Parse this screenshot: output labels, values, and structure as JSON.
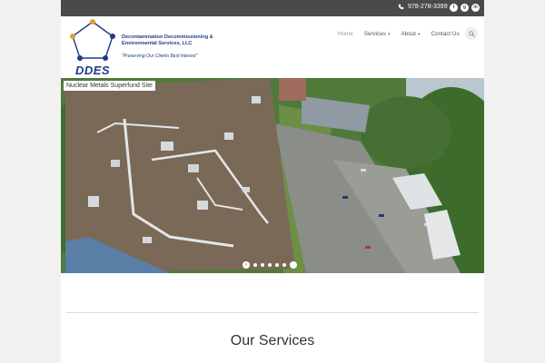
{
  "topbar": {
    "phone": "978-278-3399",
    "social_icons": [
      "twitter-icon",
      "google-plus-icon",
      "linkedin-icon"
    ]
  },
  "logo": {
    "mark_text": "DDES",
    "company_name": "Decontamination Decommissioning & Environmental Services, LLC",
    "tagline": "\"Preserving Our Clients Best Interest\""
  },
  "nav": {
    "home": "Home",
    "services": "Services",
    "about": "About",
    "contact": "Contact Us"
  },
  "slider": {
    "caption": "Nuclear Metals Superfund Site",
    "slide_count": 6,
    "active_slide": 1
  },
  "section": {
    "title": "Our Services"
  },
  "colors": {
    "topbar": "#4a4a4a",
    "brand_blue": "#1f3a8a",
    "nav_active": "#9a9a9a"
  }
}
